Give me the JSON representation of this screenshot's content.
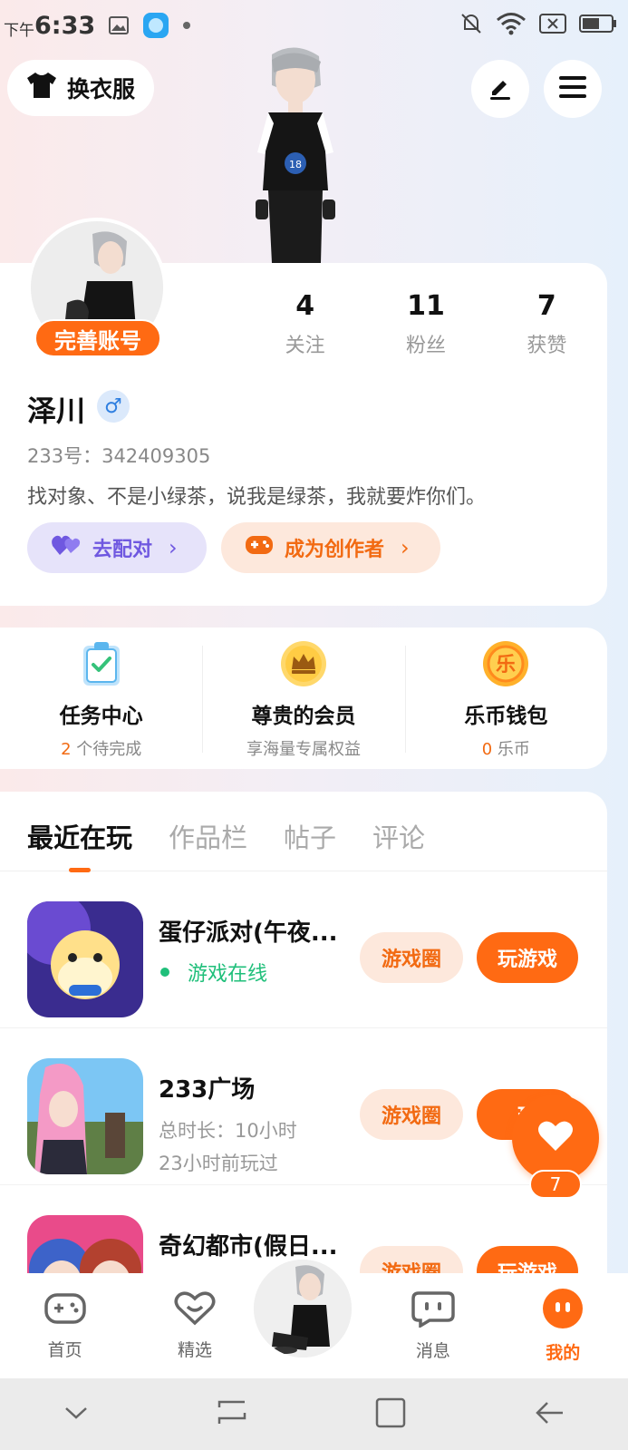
{
  "status_bar": {
    "time_prefix": "下午",
    "time": "6:33"
  },
  "header": {
    "outfit_label": "换衣服",
    "icons": [
      "tshirt-icon",
      "edit-icon",
      "menu-icon"
    ]
  },
  "profile": {
    "complete_badge": "完善账号",
    "stats": [
      {
        "value": "4",
        "label": "关注"
      },
      {
        "value": "11",
        "label": "粉丝"
      },
      {
        "value": "7",
        "label": "获赞"
      }
    ],
    "name": "泽川",
    "gender_symbol": "♂",
    "uid": "233号：342409305",
    "bio": "找对象、不是小绿茶，说我是绿茶，我就要炸你们。",
    "match_label": "去配对",
    "creator_label": "成为创作者",
    "colors": {
      "accent": "#ff6a13",
      "match": "#6f58e0"
    }
  },
  "features": [
    {
      "title": "任务中心",
      "sub_count": "2",
      "sub_text": " 个待完成"
    },
    {
      "title": "尊贵的会员",
      "sub_count": "",
      "sub_text": "享海量专属权益"
    },
    {
      "title": "乐币钱包",
      "sub_count": "0",
      "sub_text": " 乐币"
    }
  ],
  "tabs": [
    "最近在玩",
    "作品栏",
    "帖子",
    "评论"
  ],
  "games": [
    {
      "name": "蛋仔派对(午夜...",
      "status": "游戏在线",
      "meta1": "",
      "meta2": "",
      "circle_label": "游戏圈",
      "play_label": "玩游戏"
    },
    {
      "name": "233广场",
      "status": "",
      "meta1": "总时长：10小时",
      "meta2": "23小时前玩过",
      "circle_label": "游戏圈",
      "play_label": "玩"
    },
    {
      "name": "奇幻都市(假日...",
      "status": "",
      "meta1": "",
      "meta2": "",
      "circle_label": "游戏圈",
      "play_label": "玩游戏"
    }
  ],
  "like_fab": {
    "count": "7"
  },
  "nav": [
    {
      "label": "首页"
    },
    {
      "label": "精选"
    },
    {
      "label": "消息"
    },
    {
      "label": "我的"
    }
  ]
}
